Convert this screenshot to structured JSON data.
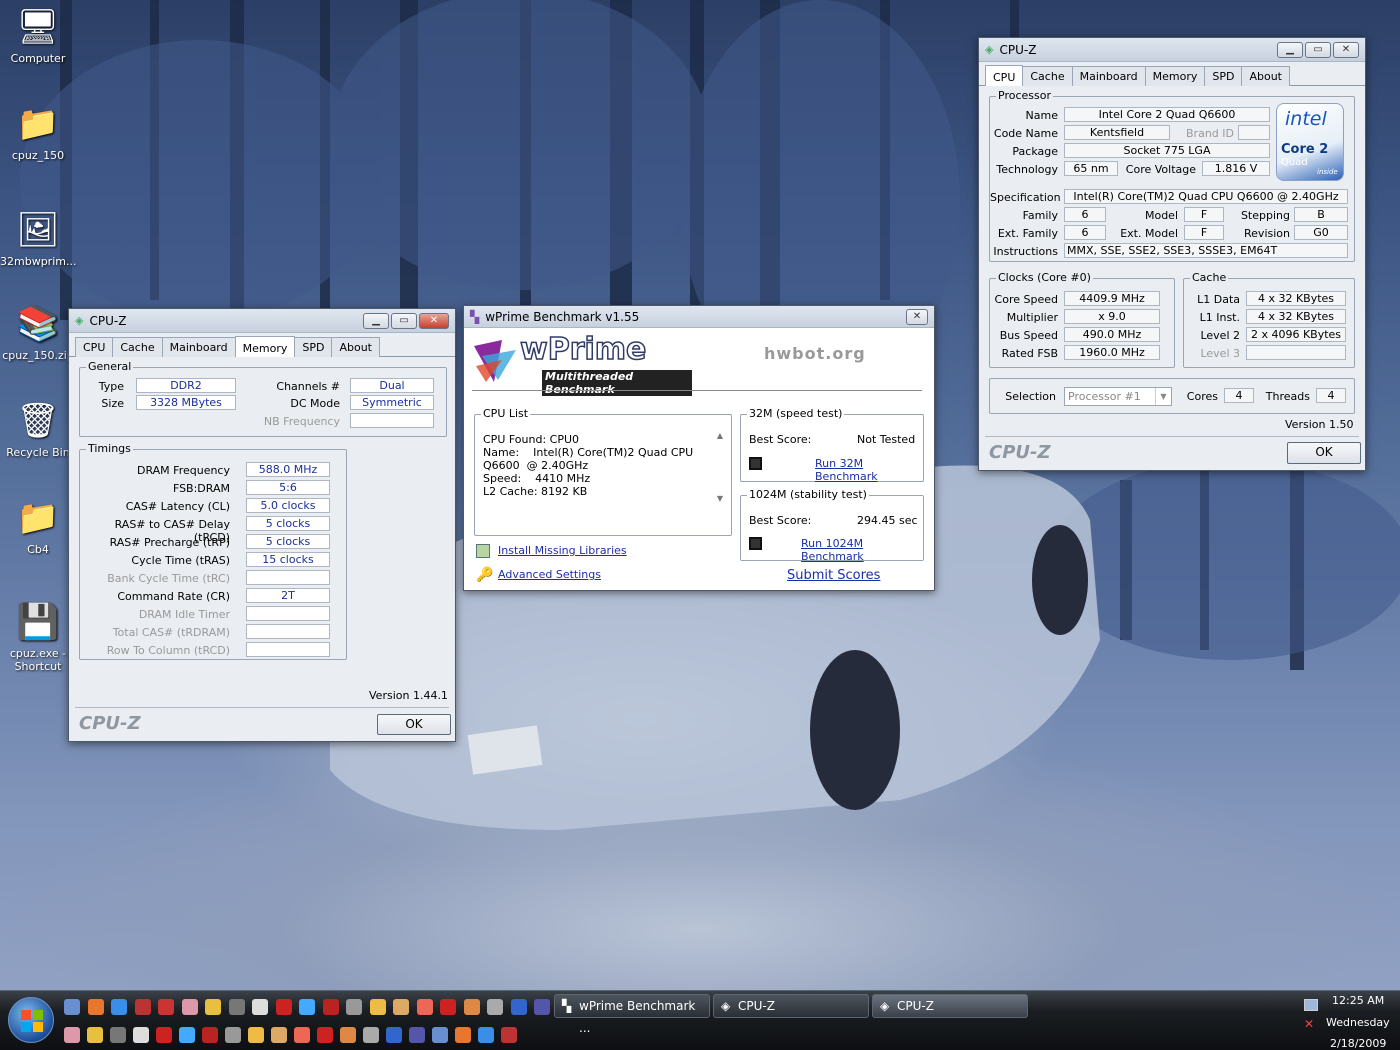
{
  "desktop": {
    "icons": [
      {
        "label": "Computer",
        "icon": "computer-icon"
      },
      {
        "label": "cpuz_150",
        "icon": "folder-icon"
      },
      {
        "label": "32mbwprim...",
        "icon": "shortcut-image-icon"
      },
      {
        "label": "cpuz_150.zip",
        "icon": "winrar-archive-icon"
      },
      {
        "label": "Recycle Bin",
        "icon": "recycle-bin-icon"
      },
      {
        "label": "Cb4",
        "icon": "folder-shortcut-icon"
      },
      {
        "label": "cpuz.exe - Shortcut",
        "icon": "exe-shortcut-icon"
      }
    ]
  },
  "cpuz_memory": {
    "title": "CPU-Z",
    "tabs": [
      "CPU",
      "Cache",
      "Mainboard",
      "Memory",
      "SPD",
      "About"
    ],
    "active_tab": "Memory",
    "general": {
      "title": "General",
      "type_label": "Type",
      "type": "DDR2",
      "size_label": "Size",
      "size": "3328 MBytes",
      "channels_label": "Channels #",
      "channels": "Dual",
      "dc_label": "DC Mode",
      "dc": "Symmetric",
      "nb_label": "NB Frequency",
      "nb": ""
    },
    "timings": {
      "title": "Timings",
      "rows": [
        {
          "label": "DRAM Frequency",
          "value": "588.0 MHz",
          "enabled": true
        },
        {
          "label": "FSB:DRAM",
          "value": "5:6",
          "enabled": true
        },
        {
          "label": "CAS# Latency (CL)",
          "value": "5.0 clocks",
          "enabled": true
        },
        {
          "label": "RAS# to CAS# Delay (tRCD)",
          "value": "5 clocks",
          "enabled": true
        },
        {
          "label": "RAS# Precharge (tRP)",
          "value": "5 clocks",
          "enabled": true
        },
        {
          "label": "Cycle Time (tRAS)",
          "value": "15 clocks",
          "enabled": true
        },
        {
          "label": "Bank Cycle Time (tRC)",
          "value": "",
          "enabled": false
        },
        {
          "label": "Command Rate (CR)",
          "value": "2T",
          "enabled": true
        },
        {
          "label": "DRAM Idle Timer",
          "value": "",
          "enabled": false
        },
        {
          "label": "Total CAS# (tRDRAM)",
          "value": "",
          "enabled": false
        },
        {
          "label": "Row To Column (tRCD)",
          "value": "",
          "enabled": false
        }
      ]
    },
    "version": "Version 1.44.1",
    "brand": "CPU-Z",
    "ok": "OK"
  },
  "wprime": {
    "title": "wPrime Benchmark v1.55",
    "logo": "wPrime",
    "logo_sub": "Multithreaded Benchmark",
    "hwbot": "hwbot.org",
    "cpu_list_title": "CPU List",
    "cpu_list": [
      "CPU Found: CPU0",
      "Name:    Intel(R) Core(TM)2 Quad CPU",
      "Q6600  @ 2.40GHz",
      "Speed:    4410 MHz",
      "L2 Cache: 8192 KB"
    ],
    "speed_title": "32M (speed test)",
    "speed_best_label": "Best Score:",
    "speed_best": "Not Tested",
    "speed_run": "Run 32M Benchmark",
    "stab_title": "1024M (stability test)",
    "stab_best_label": "Best Score:",
    "stab_best": "294.45 sec",
    "stab_run": "Run 1024M Benchmark",
    "install": "Install Missing Libraries",
    "advanced": "Advanced Settings",
    "submit": "Submit Scores"
  },
  "cpuz_cpu": {
    "title": "CPU-Z",
    "tabs": [
      "CPU",
      "Cache",
      "Mainboard",
      "Memory",
      "SPD",
      "About"
    ],
    "active_tab": "CPU",
    "processor": {
      "title": "Processor",
      "name_label": "Name",
      "name": "Intel Core 2 Quad Q6600",
      "code_label": "Code Name",
      "code": "Kentsfield",
      "brand_label": "Brand ID",
      "brand": "",
      "package_label": "Package",
      "package": "Socket 775 LGA",
      "tech_label": "Technology",
      "tech": "65 nm",
      "voltage_label": "Core Voltage",
      "voltage": "1.816 V",
      "spec_label": "Specification",
      "spec": "Intel(R) Core(TM)2 Quad CPU    Q6600  @ 2.40GHz",
      "family_label": "Family",
      "family": "6",
      "model_label": "Model",
      "model": "F",
      "stepping_label": "Stepping",
      "stepping": "B",
      "extfam_label": "Ext. Family",
      "extfam": "6",
      "extmodel_label": "Ext. Model",
      "extmodel": "F",
      "revision_label": "Revision",
      "revision": "G0",
      "instr_label": "Instructions",
      "instr": "MMX, SSE, SSE2, SSE3, SSSE3, EM64T"
    },
    "logo": {
      "brand": "intel",
      "line1": "Core 2",
      "line2": "Quad",
      "line3": "inside"
    },
    "clocks": {
      "title": "Clocks (Core #0)",
      "speed_label": "Core Speed",
      "speed": "4409.9 MHz",
      "mult_label": "Multiplier",
      "mult": "x 9.0",
      "bus_label": "Bus Speed",
      "bus": "490.0 MHz",
      "fsb_label": "Rated FSB",
      "fsb": "1960.0 MHz"
    },
    "cache": {
      "title": "Cache",
      "l1d_label": "L1 Data",
      "l1d": "4 x 32 KBytes",
      "l1i_label": "L1 Inst.",
      "l1i": "4 x 32 KBytes",
      "l2_label": "Level 2",
      "l2": "2 x 4096 KBytes",
      "l3_label": "Level 3",
      "l3": ""
    },
    "selection_label": "Selection",
    "selection": "Processor #1",
    "cores_label": "Cores",
    "cores": "4",
    "threads_label": "Threads",
    "threads": "4",
    "version": "Version 1.50",
    "brand": "CPU-Z",
    "ok": "OK"
  },
  "taskbar": {
    "tasks": [
      {
        "label": "wPrime Benchmark ..."
      },
      {
        "label": "CPU-Z"
      },
      {
        "label": "CPU-Z"
      }
    ],
    "clock": {
      "time": "12:25 AM",
      "day": "Wednesday",
      "date": "2/18/2009"
    }
  }
}
